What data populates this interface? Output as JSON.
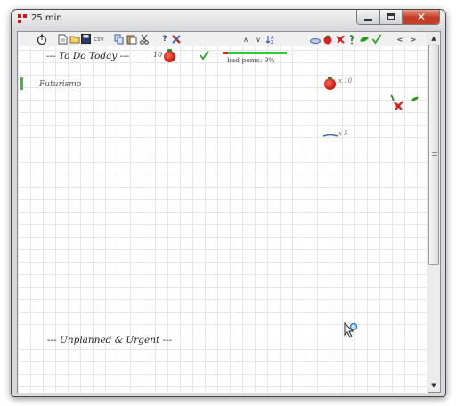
{
  "window": {
    "title": "25 min",
    "close_glyph": "✕"
  },
  "toolbar": {
    "csv_label": "csv",
    "help_label": "?",
    "nav_up": "∧",
    "nav_down": "∨",
    "prev_label": "<",
    "next_label": ">"
  },
  "sections": {
    "todo_heading": "--- To Do Today ---",
    "todo_count": "10",
    "unplanned_heading": "--- Unplanned & Urgent ---"
  },
  "progress": {
    "label": "bad poms: 9%",
    "bad_fraction": 0.09,
    "bad_color": "#d42020",
    "good_color": "#2ecc2e"
  },
  "tasks": [
    {
      "name": "Futurismo"
    }
  ],
  "stats": {
    "tomato_count": "x 10",
    "line_count": "x 5"
  },
  "colors": {
    "accent_green": "#4caf50",
    "tomato_red": "#c41208"
  }
}
